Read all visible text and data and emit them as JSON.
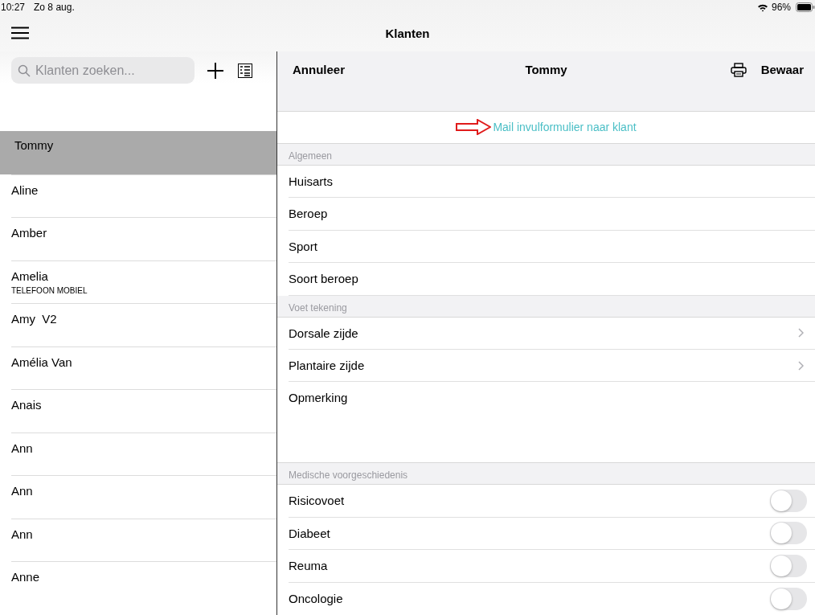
{
  "status_bar": {
    "time": "10:27",
    "date": "Zo 8 aug.",
    "battery": "96%"
  },
  "nav": {
    "title": "Klanten"
  },
  "sidebar": {
    "search": {
      "placeholder": "Klanten zoeken..."
    },
    "clients": [
      {
        "name": "Tommy",
        "selected": true
      },
      {
        "name": "Aline",
        "selected": false
      },
      {
        "name": "Amber",
        "selected": false
      },
      {
        "name": "Amelia",
        "subtitle": "TELEFOON MOBIEL",
        "selected": false
      },
      {
        "name": "Amy  V2",
        "selected": false
      },
      {
        "name": "Amélia Van",
        "selected": false
      },
      {
        "name": "Anais",
        "selected": false
      },
      {
        "name": "Ann",
        "selected": false
      },
      {
        "name": "Ann",
        "selected": false
      },
      {
        "name": "Ann",
        "selected": false
      },
      {
        "name": "Anne",
        "selected": false
      }
    ]
  },
  "detail": {
    "cancel": "Annuleer",
    "title": "Tommy",
    "save": "Bewaar",
    "mail_link": "Mail invulformulier naar klant",
    "sections": [
      {
        "header": "Algemeen",
        "rows": [
          {
            "kind": "text",
            "label": "Huisarts"
          },
          {
            "kind": "text",
            "label": "Beroep"
          },
          {
            "kind": "text",
            "label": "Sport"
          },
          {
            "kind": "text",
            "label": "Soort beroep"
          }
        ]
      },
      {
        "header": "Voet tekening",
        "rows": [
          {
            "kind": "nav",
            "label": "Dorsale zijde"
          },
          {
            "kind": "nav",
            "label": "Plantaire zijde"
          },
          {
            "kind": "note",
            "label": "Opmerking"
          }
        ]
      },
      {
        "header": "Medische voorgeschiedenis",
        "rows": [
          {
            "kind": "toggle",
            "label": "Risicovoet",
            "on": false
          },
          {
            "kind": "toggle",
            "label": "Diabeet",
            "on": false
          },
          {
            "kind": "toggle",
            "label": "Reuma",
            "on": false
          },
          {
            "kind": "toggle",
            "label": "Oncologie",
            "on": false
          }
        ]
      }
    ]
  }
}
